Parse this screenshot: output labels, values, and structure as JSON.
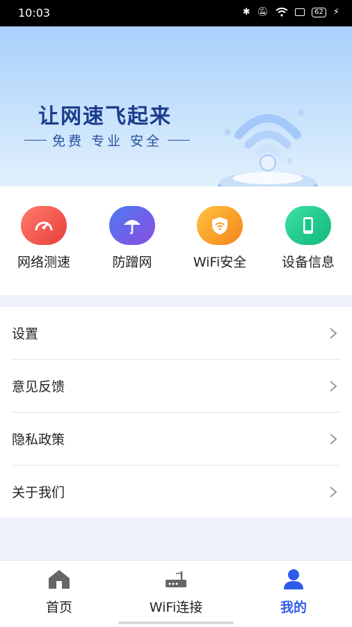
{
  "status_bar": {
    "time": "10:03",
    "battery": "62"
  },
  "banner": {
    "title": "让网速飞起来",
    "subtitle": "免费 专业 安全"
  },
  "quick_actions": [
    {
      "label": "网络测速",
      "icon": "speedometer-icon",
      "color": "#f0584c"
    },
    {
      "label": "防蹭网",
      "icon": "umbrella-icon",
      "color": "#6a4fe0"
    },
    {
      "label": "WiFi安全",
      "icon": "wifi-shield-icon",
      "color": "#f59a1c"
    },
    {
      "label": "设备信息",
      "icon": "phone-icon",
      "color": "#18c58a"
    }
  ],
  "menu": [
    {
      "label": "设置"
    },
    {
      "label": "意见反馈"
    },
    {
      "label": "隐私政策"
    },
    {
      "label": "关于我们"
    }
  ],
  "tabs": [
    {
      "label": "首页",
      "icon": "home-icon"
    },
    {
      "label": "WiFi连接",
      "icon": "router-icon"
    },
    {
      "label": "我的",
      "icon": "user-icon",
      "active": true
    }
  ],
  "colors": {
    "accent": "#2f5bea",
    "banner_text": "#1c3c8c"
  }
}
